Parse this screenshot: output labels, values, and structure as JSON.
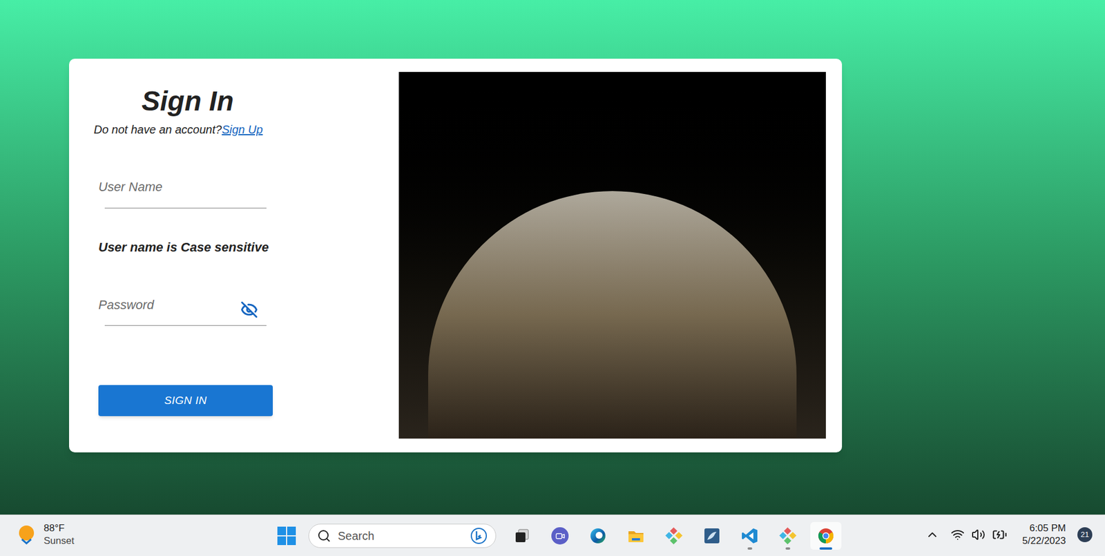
{
  "signin": {
    "title": "Sign In",
    "prompt": "Do not have an account?",
    "signup_link": "Sign Up",
    "username": {
      "placeholder": "User Name",
      "value": ""
    },
    "hint": "User name is Case sensitive",
    "password": {
      "placeholder": "Password",
      "value": "",
      "visible": false
    },
    "button": "SIGN IN"
  },
  "taskbar": {
    "weather": {
      "temperature": "88°F",
      "condition": "Sunset"
    },
    "search": {
      "placeholder": "Search"
    },
    "apps": [
      {
        "kind": "taskview",
        "running": false,
        "active": false
      },
      {
        "kind": "chat",
        "running": false,
        "active": false
      },
      {
        "kind": "edge",
        "running": false,
        "active": false
      },
      {
        "kind": "explorer",
        "running": false,
        "active": false
      },
      {
        "kind": "kraken",
        "running": false,
        "active": false
      },
      {
        "kind": "workbench",
        "running": false,
        "active": false
      },
      {
        "kind": "vscode",
        "running": true,
        "active": false
      },
      {
        "kind": "kraken",
        "running": true,
        "active": false
      },
      {
        "kind": "chrome",
        "running": true,
        "active": true
      }
    ],
    "tray": {
      "time": "6:05 PM",
      "date": "5/22/2023",
      "notifications": "21"
    }
  }
}
